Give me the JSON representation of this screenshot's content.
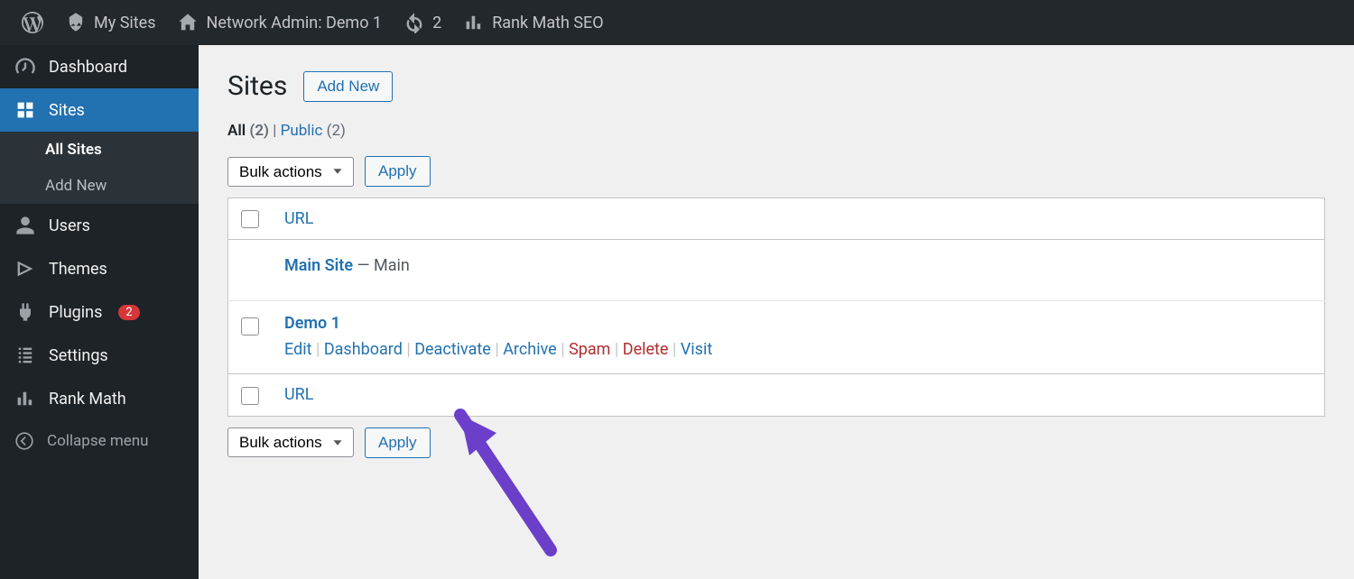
{
  "adminbar": {
    "my_sites": "My Sites",
    "network_admin": "Network Admin: Demo 1",
    "updates_count": "2",
    "rankmath": "Rank Math SEO"
  },
  "sidebar": {
    "items": [
      {
        "label": "Dashboard"
      },
      {
        "label": "Sites"
      },
      {
        "label": "Users"
      },
      {
        "label": "Themes"
      },
      {
        "label": "Plugins",
        "badge": "2"
      },
      {
        "label": "Settings"
      },
      {
        "label": "Rank Math"
      }
    ],
    "submenu": {
      "all_sites": "All Sites",
      "add_new": "Add New"
    },
    "collapse": "Collapse menu"
  },
  "page": {
    "title": "Sites",
    "add_new": "Add New",
    "filters": {
      "all_label": "All",
      "all_count": "(2)",
      "public_label": "Public",
      "public_count": "(2)",
      "sep": " | "
    },
    "bulk_actions": "Bulk actions",
    "apply": "Apply",
    "column_url": "URL",
    "rows": [
      {
        "name": "Main Site",
        "tag": " — Main"
      },
      {
        "name": "Demo 1"
      }
    ],
    "row_actions": {
      "edit": "Edit",
      "dashboard": "Dashboard",
      "deactivate": "Deactivate",
      "archive": "Archive",
      "spam": "Spam",
      "delete_": "Delete",
      "visit": "Visit"
    }
  }
}
